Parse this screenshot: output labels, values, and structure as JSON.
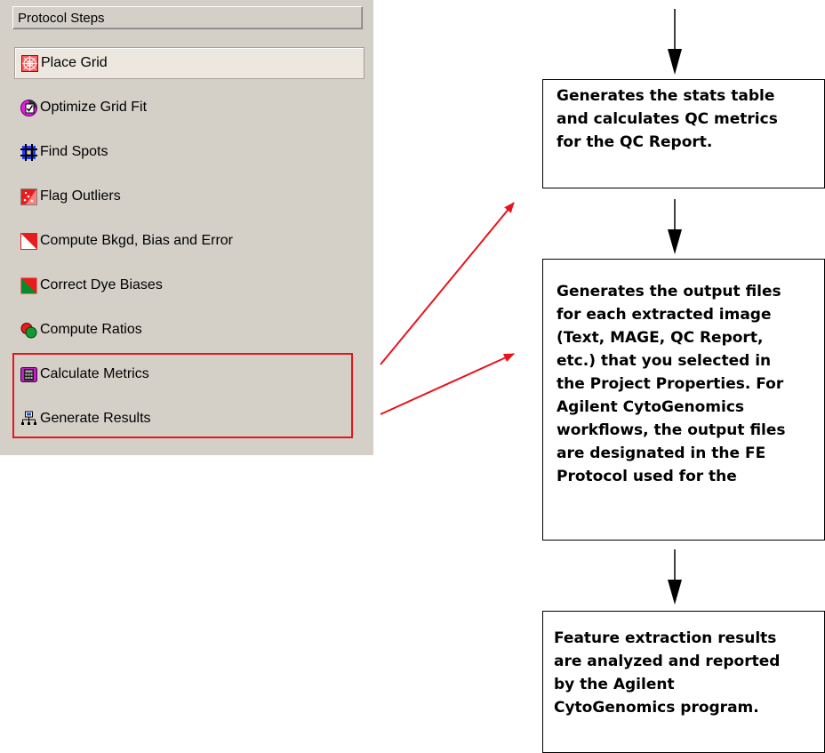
{
  "panel": {
    "header": "Protocol Steps",
    "steps": [
      {
        "label": "Place Grid",
        "icon": "place-grid-icon",
        "selected": true
      },
      {
        "label": "Optimize Grid Fit",
        "icon": "optimize-grid-fit-icon",
        "selected": false
      },
      {
        "label": "Find Spots",
        "icon": "find-spots-icon",
        "selected": false
      },
      {
        "label": "Flag Outliers",
        "icon": "flag-outliers-icon",
        "selected": false
      },
      {
        "label": "Compute Bkgd, Bias and Error",
        "icon": "compute-bkgd-icon",
        "selected": false
      },
      {
        "label": "Correct Dye Biases",
        "icon": "correct-dye-biases-icon",
        "selected": false
      },
      {
        "label": "Compute Ratios",
        "icon": "compute-ratios-icon",
        "selected": false
      },
      {
        "label": "Calculate Metrics",
        "icon": "calculate-metrics-icon",
        "selected": false
      },
      {
        "label": "Generate Results",
        "icon": "generate-results-icon",
        "selected": false
      }
    ],
    "highlight_color": "#e8141c"
  },
  "flow": {
    "box1_lines": [
      "Generates the stats table",
      "and calculates QC metrics",
      "for the QC Report."
    ],
    "box2_lines": [
      "Generates the output files",
      "for each extracted image",
      "(Text, MAGE, QC Report,",
      "etc.) that you selected in",
      "the Project Properties. For",
      "Agilent CytoGenomics",
      "workflows, the output files",
      "are designated in the FE",
      "Protocol used for the"
    ],
    "box3_lines": [
      "Feature extraction results",
      "are analyzed and reported",
      "by the Agilent",
      "CytoGenomics program."
    ]
  }
}
